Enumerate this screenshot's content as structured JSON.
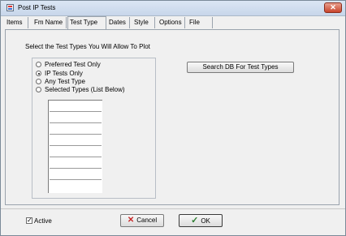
{
  "window": {
    "title": "Post IP Tests",
    "close_glyph": "✕"
  },
  "tabs": [
    {
      "label": "Items"
    },
    {
      "label": "Fm Name"
    },
    {
      "label": "Test Type"
    },
    {
      "label": "Dates"
    },
    {
      "label": "Style"
    },
    {
      "label": "Options"
    },
    {
      "label": "File"
    }
  ],
  "active_tab": "Test Type",
  "section": {
    "heading": "Select the Test Types  You Will Allow To Plot"
  },
  "radio_options": [
    {
      "label": "Preferred Test Only",
      "checked": false
    },
    {
      "label": "IP Tests Only",
      "checked": true
    },
    {
      "label": "Any Test Type",
      "checked": false
    },
    {
      "label": "Selected Types (List Below)",
      "checked": false
    }
  ],
  "selected_types_list": [
    "",
    "",
    "",
    "",
    "",
    "",
    "",
    "",
    ""
  ],
  "buttons": {
    "search": "Search DB For Test Types",
    "cancel": "Cancel",
    "ok": "OK"
  },
  "footer": {
    "active_label": "Active",
    "active_checked": true,
    "check_glyph": "✓",
    "x_glyph": "✕"
  }
}
